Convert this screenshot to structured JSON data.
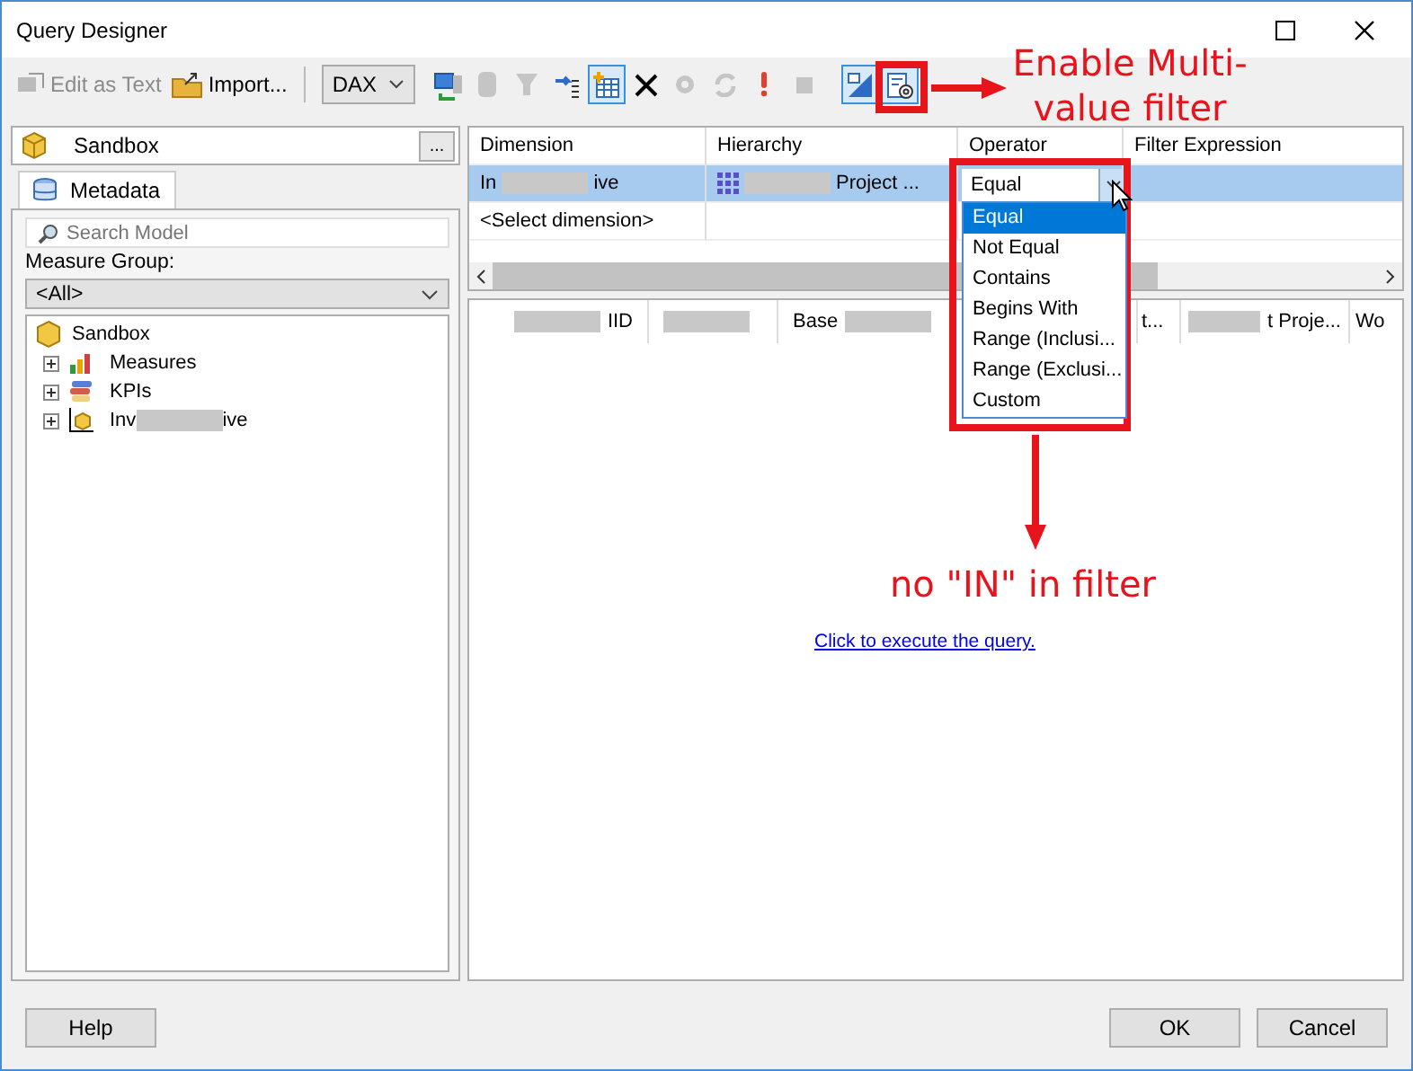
{
  "window": {
    "title": "Query Designer"
  },
  "toolbar": [
    {
      "kind": "button",
      "label": "Edit as Text",
      "disabled": true
    },
    {
      "kind": "button",
      "label": "Import...",
      "disabled": false
    },
    {
      "kind": "separator"
    },
    {
      "kind": "dropdown",
      "label": "DAX"
    },
    {
      "kind": "icon",
      "disabled": false,
      "selected": false
    },
    {
      "kind": "icon",
      "disabled": true,
      "selected": false
    },
    {
      "kind": "icon",
      "disabled": true,
      "selected": false
    },
    {
      "kind": "icon",
      "disabled": false,
      "selected": false
    },
    {
      "kind": "icon",
      "disabled": false,
      "selected": true
    },
    {
      "kind": "icon",
      "disabled": false,
      "selected": false
    },
    {
      "kind": "icon",
      "disabled": true,
      "selected": false
    },
    {
      "kind": "icon",
      "disabled": true,
      "selected": false
    },
    {
      "kind": "icon",
      "disabled": false,
      "selected": false
    },
    {
      "kind": "icon",
      "disabled": true,
      "selected": false
    },
    {
      "kind": "icon",
      "disabled": false,
      "selected": true
    },
    {
      "kind": "icon",
      "disabled": false,
      "selected": true
    }
  ],
  "cube": {
    "name": "Sandbox",
    "browse": "..."
  },
  "metadata_tab": {
    "label": "Metadata",
    "selected": true
  },
  "search": {
    "placeholder": "Search Model"
  },
  "measure_group": {
    "label": "Measure Group:",
    "value": "<All>"
  },
  "tree": [
    {
      "label": "Sandbox",
      "children": [
        {
          "label": [
            {
              "kind": "text",
              "text": "Measures"
            }
          ],
          "expanded": false
        },
        {
          "label": [
            {
              "kind": "text",
              "text": "KPIs"
            }
          ],
          "expanded": false
        },
        {
          "label": [
            {
              "kind": "text",
              "text": "Inv"
            },
            {
              "kind": "redacted"
            },
            {
              "kind": "text",
              "text": "ive"
            }
          ],
          "expanded": false
        }
      ]
    }
  ],
  "filter_grid": {
    "columns": [
      "Dimension",
      "Hierarchy",
      "Operator",
      "Filter Expression"
    ],
    "rows": [
      {
        "selected": true,
        "dimension": [
          {
            "kind": "text",
            "text": "In"
          },
          {
            "kind": "redacted"
          },
          {
            "kind": "text",
            "text": "ive"
          }
        ],
        "hierarchy": [
          {
            "kind": "redacted"
          },
          {
            "kind": "text",
            "text": "Project ..."
          }
        ],
        "operator": "Equal"
      },
      {
        "selected": false,
        "dimension": [
          {
            "kind": "text",
            "text": "<Select dimension>"
          }
        ]
      }
    ],
    "operator_options": [
      {
        "label": "Equal",
        "selected": true
      },
      {
        "label": "Not Equal",
        "selected": false
      },
      {
        "label": "Contains",
        "selected": false
      },
      {
        "label": "Begins With",
        "selected": false
      },
      {
        "label": "Range (Inclusi...",
        "selected": false
      },
      {
        "label": "Range (Exclusi...",
        "selected": false
      },
      {
        "label": "Custom",
        "selected": false
      }
    ]
  },
  "result_grid": {
    "columns": [
      [
        {
          "kind": "redacted"
        },
        {
          "kind": "text",
          "text": "IID"
        }
      ],
      [
        {
          "kind": "redacted"
        }
      ],
      [
        {
          "kind": "text",
          "text": "Base"
        },
        {
          "kind": "redacted"
        }
      ],
      [
        {
          "kind": "text",
          "text": "t..."
        }
      ],
      [
        {
          "kind": "redacted"
        },
        {
          "kind": "text",
          "text": "t Proje..."
        }
      ],
      [
        {
          "kind": "text",
          "text": "Wo"
        }
      ]
    ],
    "execute_link": "Click to execute the query."
  },
  "annotations": [
    {
      "kind": "toolbar",
      "text": "Enable Multi-value filter"
    },
    {
      "kind": "dropdown",
      "text": "no \"IN\" in filter"
    }
  ],
  "buttons": [
    {
      "label": "Help"
    },
    {
      "label": "OK"
    },
    {
      "label": "Cancel"
    }
  ]
}
